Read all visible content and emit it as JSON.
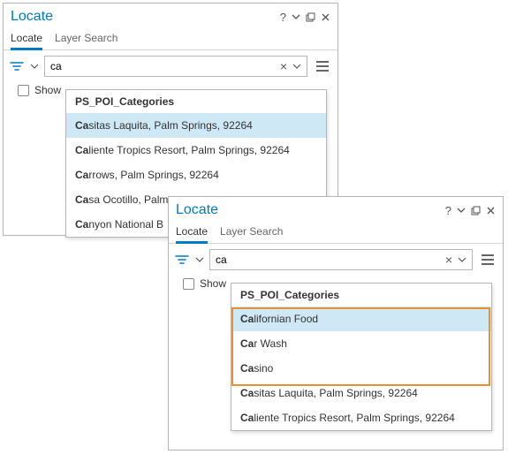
{
  "pane1": {
    "title": "Locate",
    "tabs": {
      "locate": "Locate",
      "layer": "Layer Search"
    },
    "search_value": "ca",
    "show_label": "Show",
    "suggestions": {
      "header": "PS_POI_Categories",
      "items": [
        {
          "bold": "Ca",
          "rest": "sitas Laquita, Palm Springs, 92264"
        },
        {
          "bold": "Ca",
          "rest": "liente Tropics Resort, Palm Springs, 92264"
        },
        {
          "bold": "Ca",
          "rest": "rrows, Palm Springs, 92264"
        },
        {
          "bold": "Ca",
          "rest": "sa Ocotillo, Palm"
        },
        {
          "bold": "Ca",
          "rest": "nyon National B"
        }
      ]
    }
  },
  "pane2": {
    "title": "Locate",
    "tabs": {
      "locate": "Locate",
      "layer": "Layer Search"
    },
    "search_value": "ca",
    "show_label": "Show",
    "suggestions": {
      "header": "PS_POI_Categories",
      "items": [
        {
          "bold": "Ca",
          "rest": "lifornian Food"
        },
        {
          "bold": "Ca",
          "rest": "r Wash"
        },
        {
          "bold": "Ca",
          "rest": "sino"
        },
        {
          "bold": "Ca",
          "rest": "sitas Laquita, Palm Springs, 92264"
        },
        {
          "bold": "Ca",
          "rest": "liente Tropics Resort, Palm Springs, 92264"
        }
      ]
    }
  }
}
